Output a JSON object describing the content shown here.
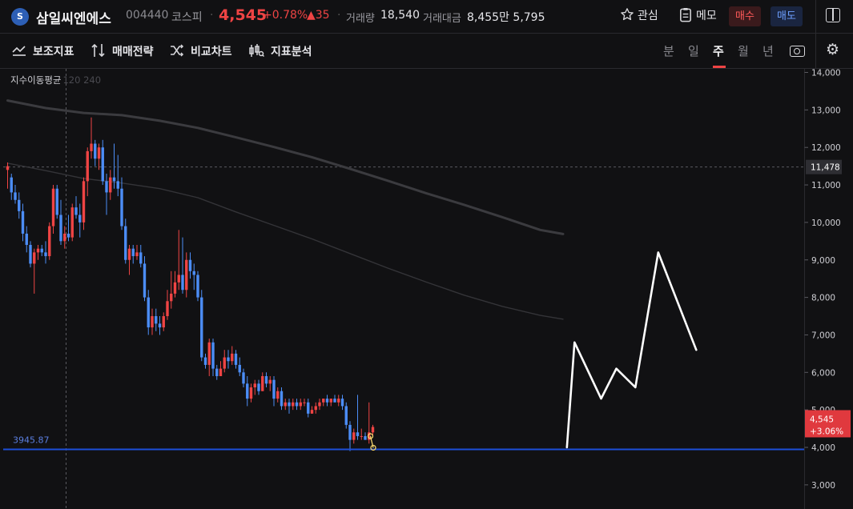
{
  "header": {
    "logo_text": "S",
    "stock_name": "삼일씨엔에스",
    "stock_code": "004440",
    "market": "코스피",
    "price": "4,545",
    "change_pct": "+0.78%",
    "change_abs": "▲35",
    "volume_label": "거래량",
    "volume": "18,540",
    "value_label": "거래대금",
    "value": "8,455만 5,795",
    "watch_label": "관심",
    "memo_label": "메모",
    "buy_label": "매수",
    "sell_label": "매도",
    "up_color": "#ef4444",
    "down_color": "#4c8df6"
  },
  "toolbar": {
    "tools": [
      "보조지표",
      "매매전략",
      "비교차트",
      "지표분석"
    ],
    "periods": [
      "분",
      "일",
      "주",
      "월",
      "년"
    ],
    "active_period": "주"
  },
  "indicator": {
    "label": "지수이동평균",
    "params": "120 240"
  },
  "chart_data": {
    "type": "candlestick",
    "interval": "weekly",
    "yaxis": {
      "ticks": [
        "14,000",
        "13,000",
        "12,000",
        "11,000",
        "10,000",
        "9,000",
        "8,000",
        "7,000",
        "6,000",
        "5,000",
        "4,000",
        "3,000"
      ],
      "ylim": [
        2800,
        14100
      ],
      "side": "right"
    },
    "crosshair_value": "11,478",
    "crosshair_y": 11478,
    "support_line": {
      "label": "3945.87",
      "value": 3945.87,
      "color": "#1d4ed8"
    },
    "last_price": {
      "price": "4,545",
      "change": "+3.06%",
      "value": 4545
    },
    "candles_ohlc": [
      [
        11400,
        11600,
        10900,
        11500
      ],
      [
        11200,
        11300,
        10600,
        10800
      ],
      [
        10800,
        11000,
        10500,
        10600
      ],
      [
        10600,
        10800,
        10100,
        10300
      ],
      [
        10300,
        10500,
        9500,
        9700
      ],
      [
        9700,
        9900,
        9200,
        9400
      ],
      [
        9400,
        9500,
        8800,
        8900
      ],
      [
        8900,
        9300,
        8100,
        9200
      ],
      [
        9200,
        9400,
        9000,
        9300
      ],
      [
        9300,
        9400,
        9100,
        9200
      ],
      [
        9200,
        9500,
        8900,
        9100
      ],
      [
        9100,
        10000,
        9000,
        9900
      ],
      [
        9900,
        11000,
        9700,
        10900
      ],
      [
        10900,
        11000,
        10100,
        10200
      ],
      [
        10200,
        10600,
        9400,
        9500
      ],
      [
        9500,
        9900,
        9300,
        9700
      ],
      [
        9700,
        10200,
        9500,
        9600
      ],
      [
        9600,
        10500,
        9500,
        10400
      ],
      [
        10400,
        10700,
        10100,
        10200
      ],
      [
        10200,
        10500,
        9600,
        10000
      ],
      [
        10000,
        11200,
        9800,
        11100
      ],
      [
        11100,
        12000,
        10700,
        11900
      ],
      [
        11900,
        12800,
        11700,
        12100
      ],
      [
        12100,
        12200,
        11500,
        11700
      ],
      [
        11700,
        12100,
        11400,
        12000
      ],
      [
        12000,
        12200,
        11000,
        11100
      ],
      [
        11100,
        11300,
        10200,
        10800
      ],
      [
        10800,
        11400,
        10600,
        11200
      ],
      [
        11200,
        12100,
        10900,
        11100
      ],
      [
        11100,
        11800,
        10700,
        10900
      ],
      [
        10900,
        11200,
        9800,
        9900
      ],
      [
        9900,
        10100,
        8900,
        9000
      ],
      [
        9000,
        9400,
        8600,
        9300
      ],
      [
        9300,
        9400,
        8900,
        9100
      ],
      [
        9100,
        9400,
        9000,
        9200
      ],
      [
        9200,
        9400,
        8800,
        8900
      ],
      [
        8900,
        9100,
        7900,
        8000
      ],
      [
        8000,
        8200,
        7000,
        7200
      ],
      [
        7200,
        7700,
        7000,
        7500
      ],
      [
        7500,
        7700,
        7100,
        7300
      ],
      [
        7300,
        7500,
        7000,
        7200
      ],
      [
        7200,
        7600,
        7100,
        7500
      ],
      [
        7500,
        8200,
        7400,
        7900
      ],
      [
        7900,
        8700,
        7700,
        8100
      ],
      [
        8100,
        8700,
        8000,
        8400
      ],
      [
        8400,
        9800,
        8200,
        8600
      ],
      [
        8600,
        9600,
        8100,
        8200
      ],
      [
        8200,
        9200,
        8000,
        9000
      ],
      [
        9000,
        9200,
        8500,
        8700
      ],
      [
        8700,
        8900,
        8200,
        8600
      ],
      [
        8600,
        8700,
        7900,
        8000
      ],
      [
        8000,
        8200,
        6300,
        6400
      ],
      [
        6400,
        6500,
        6100,
        6200
      ],
      [
        6200,
        6900,
        5900,
        6800
      ],
      [
        6800,
        6900,
        5900,
        6100
      ],
      [
        6100,
        6200,
        5800,
        5900
      ],
      [
        5900,
        6300,
        5900,
        6100
      ],
      [
        6100,
        6600,
        6000,
        6400
      ],
      [
        6400,
        6600,
        6100,
        6300
      ],
      [
        6300,
        6700,
        6200,
        6500
      ],
      [
        6500,
        6600,
        6100,
        6200
      ],
      [
        6200,
        6400,
        5900,
        6000
      ],
      [
        6000,
        6100,
        5600,
        5700
      ],
      [
        5700,
        5900,
        5100,
        5300
      ],
      [
        5300,
        5700,
        5200,
        5600
      ],
      [
        5600,
        5800,
        5400,
        5700
      ],
      [
        5700,
        5800,
        5400,
        5500
      ],
      [
        5500,
        6000,
        5500,
        5900
      ],
      [
        5900,
        6000,
        5600,
        5700
      ],
      [
        5700,
        5900,
        5500,
        5800
      ],
      [
        5800,
        5900,
        5100,
        5300
      ],
      [
        5300,
        5600,
        5200,
        5500
      ],
      [
        5500,
        5600,
        5000,
        5100
      ],
      [
        5100,
        5300,
        5000,
        5200
      ],
      [
        5200,
        5300,
        4900,
        5100
      ],
      [
        5100,
        5300,
        5000,
        5200
      ],
      [
        5200,
        5300,
        5000,
        5100
      ],
      [
        5100,
        5300,
        5000,
        5200
      ],
      [
        5200,
        5300,
        5100,
        5200
      ],
      [
        5200,
        5300,
        4800,
        4900
      ],
      [
        4900,
        5100,
        4900,
        5000
      ],
      [
        5000,
        5200,
        4900,
        5100
      ],
      [
        5100,
        5300,
        5000,
        5200
      ],
      [
        5200,
        5300,
        5100,
        5300
      ],
      [
        5300,
        5400,
        5100,
        5200
      ],
      [
        5200,
        5300,
        5100,
        5300
      ],
      [
        5300,
        5400,
        5200,
        5200
      ],
      [
        5200,
        5400,
        5100,
        5300
      ],
      [
        5300,
        5400,
        5000,
        5100
      ],
      [
        5100,
        5200,
        4500,
        4600
      ],
      [
        4600,
        4700,
        3900,
        4200
      ],
      [
        4200,
        4500,
        4100,
        4400
      ],
      [
        4400,
        5400,
        4200,
        4300
      ],
      [
        4300,
        4500,
        4200,
        4300
      ],
      [
        4300,
        4400,
        4200,
        4200
      ],
      [
        4200,
        5200,
        4100,
        4400
      ],
      [
        4400,
        4600,
        4300,
        4545
      ]
    ],
    "ema120": [
      [
        0,
        13250
      ],
      [
        10,
        13050
      ],
      [
        20,
        12920
      ],
      [
        30,
        12860
      ],
      [
        40,
        12710
      ],
      [
        50,
        12520
      ],
      [
        60,
        12270
      ],
      [
        70,
        12010
      ],
      [
        80,
        11740
      ],
      [
        90,
        11430
      ],
      [
        100,
        11110
      ],
      [
        110,
        10780
      ],
      [
        120,
        10470
      ],
      [
        130,
        10140
      ],
      [
        140,
        9800
      ],
      [
        146,
        9690
      ]
    ],
    "ema240": [
      [
        0,
        11580
      ],
      [
        10,
        11380
      ],
      [
        20,
        11170
      ],
      [
        30,
        11050
      ],
      [
        40,
        10900
      ],
      [
        50,
        10660
      ],
      [
        60,
        10280
      ],
      [
        70,
        9920
      ],
      [
        80,
        9560
      ],
      [
        90,
        9170
      ],
      [
        100,
        8780
      ],
      [
        110,
        8410
      ],
      [
        120,
        8060
      ],
      [
        130,
        7760
      ],
      [
        140,
        7520
      ],
      [
        146,
        7420
      ]
    ],
    "projection_line": [
      [
        147,
        4000
      ],
      [
        149,
        6800
      ],
      [
        156,
        5300
      ],
      [
        160,
        6100
      ],
      [
        165,
        5600
      ],
      [
        171,
        9200
      ],
      [
        181,
        6600
      ]
    ]
  }
}
